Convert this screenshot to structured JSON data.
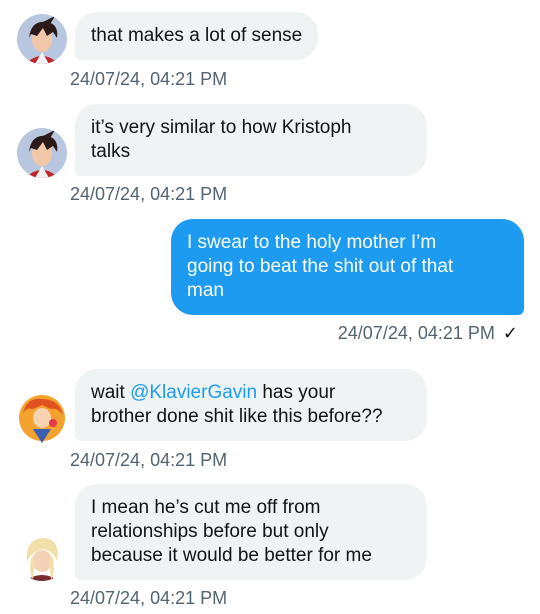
{
  "messages": [
    {
      "side": "left",
      "avatar": "apollo-avatar",
      "lines": [
        "that makes a lot of sense"
      ],
      "timestamp": "24/07/24, 04:21 PM"
    },
    {
      "side": "left",
      "avatar": "apollo-avatar",
      "lines": [
        "it’s very similar to how Kristoph",
        "talks"
      ],
      "timestamp": "24/07/24, 04:21 PM"
    },
    {
      "side": "right",
      "lines": [
        "I swear to the holy mother I’m",
        "going to beat the shit out of that",
        "man"
      ],
      "timestamp": "24/07/24, 04:21 PM",
      "status_icon": "checkmark-icon"
    },
    {
      "side": "left",
      "avatar": "orange-hair-avatar",
      "line1_prefix": "wait ",
      "mention": "@KlavierGavin",
      "line1_suffix": " has your",
      "line2": "brother done shit like this before??",
      "timestamp": "24/07/24, 04:21 PM"
    },
    {
      "side": "left",
      "avatar": "blonde-avatar",
      "lines": [
        "I mean he’s cut me off from",
        "relationships before but only",
        "because it would be better for me"
      ],
      "timestamp": "24/07/24, 04:21 PM"
    }
  ],
  "colors": {
    "sent_bubble": "#1d9bf0",
    "received_bubble": "#eff3f4",
    "mention": "#1d9bf0",
    "timestamp": "#536471"
  }
}
